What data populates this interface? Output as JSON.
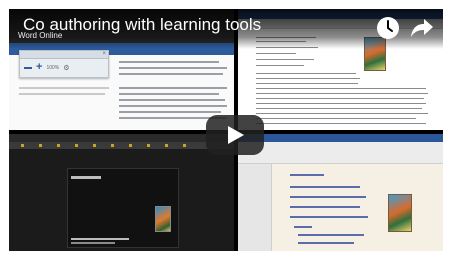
{
  "video": {
    "title": "Co authoring with learning tools",
    "channel": "Word Online"
  },
  "widget": {
    "value": "100%"
  },
  "icons": {
    "watch_later": "clock-icon",
    "share": "share-arrow-icon",
    "play": "play-icon"
  },
  "colors": {
    "word_blue": "#2b579a",
    "play_button_bg": "#212121"
  }
}
